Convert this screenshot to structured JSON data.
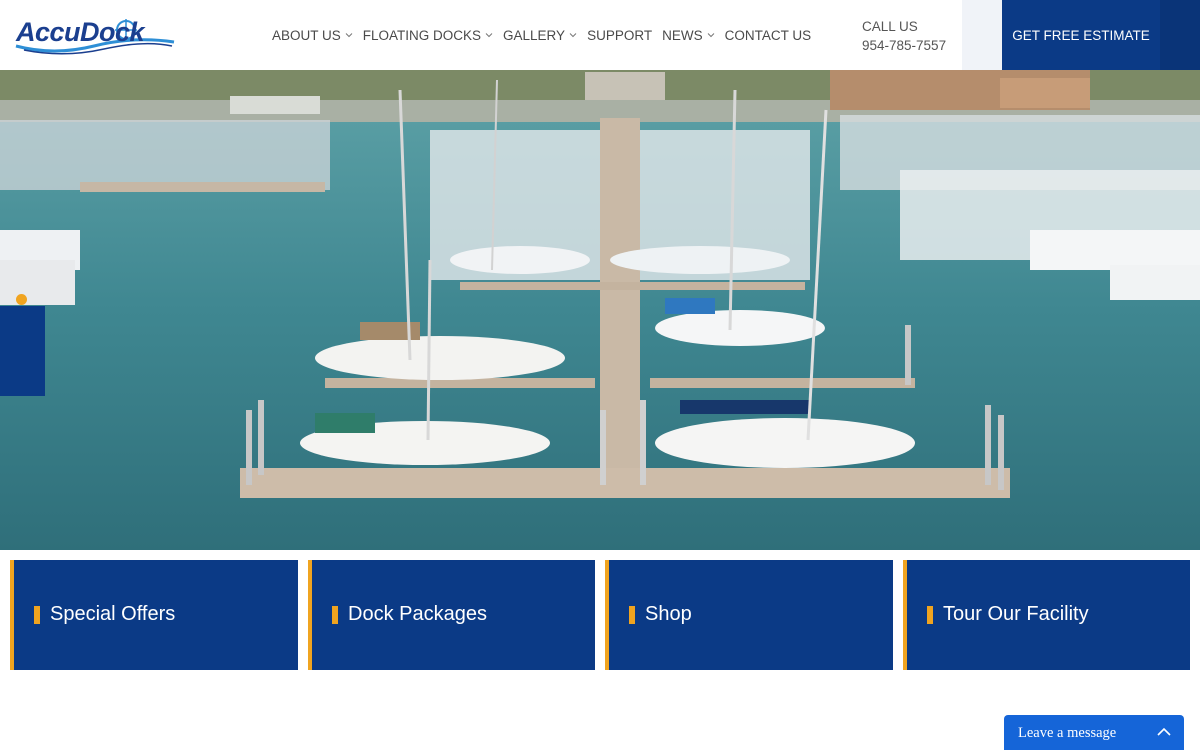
{
  "brand": {
    "logo_text": "AccuDock",
    "primary_color": "#0b3a86",
    "accent_color": "#f0a420"
  },
  "nav": {
    "items": [
      {
        "label": "ABOUT US",
        "has_dropdown": true
      },
      {
        "label": "FLOATING DOCKS",
        "has_dropdown": true
      },
      {
        "label": "GALLERY",
        "has_dropdown": true
      },
      {
        "label": "SUPPORT",
        "has_dropdown": false
      },
      {
        "label": "NEWS",
        "has_dropdown": true
      },
      {
        "label": "CONTACT US",
        "has_dropdown": false
      }
    ]
  },
  "contact": {
    "call_label": "CALL US",
    "phone": "954-785-7557"
  },
  "cta": {
    "estimate_label": "GET FREE ESTIMATE"
  },
  "hero": {
    "slides": 4,
    "active_slide": 1
  },
  "cards": [
    {
      "label": "Special Offers"
    },
    {
      "label": "Dock Packages"
    },
    {
      "label": "Shop"
    },
    {
      "label": "Tour Our Facility"
    }
  ],
  "chat": {
    "label": "Leave a message",
    "icon": "chevron-up-icon"
  }
}
